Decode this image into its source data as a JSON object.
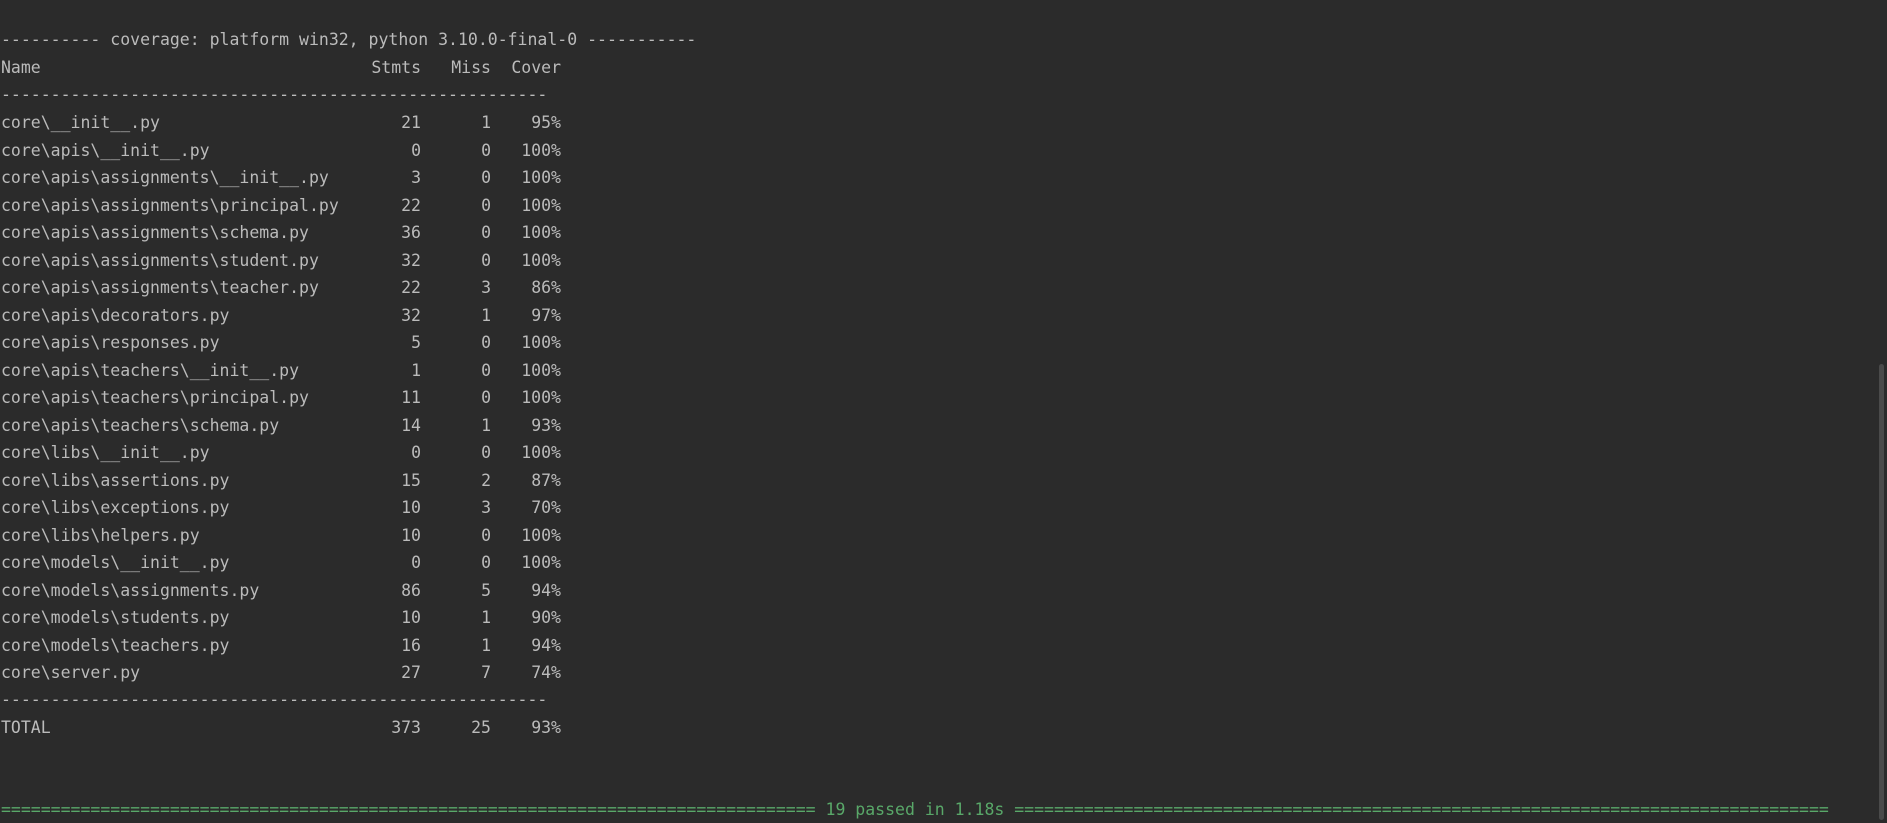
{
  "header_line": "---------- coverage: platform win32, python 3.10.0-final-0 -----------",
  "columns": {
    "name": "Name",
    "stmts": "Stmts",
    "miss": "Miss",
    "cover": "Cover"
  },
  "separator": "-------------------------------------------------------",
  "rows": [
    {
      "name": "core\\__init__.py",
      "stmts": "21",
      "miss": "1",
      "cover": "95%"
    },
    {
      "name": "core\\apis\\__init__.py",
      "stmts": "0",
      "miss": "0",
      "cover": "100%"
    },
    {
      "name": "core\\apis\\assignments\\__init__.py",
      "stmts": "3",
      "miss": "0",
      "cover": "100%"
    },
    {
      "name": "core\\apis\\assignments\\principal.py",
      "stmts": "22",
      "miss": "0",
      "cover": "100%"
    },
    {
      "name": "core\\apis\\assignments\\schema.py",
      "stmts": "36",
      "miss": "0",
      "cover": "100%"
    },
    {
      "name": "core\\apis\\assignments\\student.py",
      "stmts": "32",
      "miss": "0",
      "cover": "100%"
    },
    {
      "name": "core\\apis\\assignments\\teacher.py",
      "stmts": "22",
      "miss": "3",
      "cover": "86%"
    },
    {
      "name": "core\\apis\\decorators.py",
      "stmts": "32",
      "miss": "1",
      "cover": "97%"
    },
    {
      "name": "core\\apis\\responses.py",
      "stmts": "5",
      "miss": "0",
      "cover": "100%"
    },
    {
      "name": "core\\apis\\teachers\\__init__.py",
      "stmts": "1",
      "miss": "0",
      "cover": "100%"
    },
    {
      "name": "core\\apis\\teachers\\principal.py",
      "stmts": "11",
      "miss": "0",
      "cover": "100%"
    },
    {
      "name": "core\\apis\\teachers\\schema.py",
      "stmts": "14",
      "miss": "1",
      "cover": "93%"
    },
    {
      "name": "core\\libs\\__init__.py",
      "stmts": "0",
      "miss": "0",
      "cover": "100%"
    },
    {
      "name": "core\\libs\\assertions.py",
      "stmts": "15",
      "miss": "2",
      "cover": "87%"
    },
    {
      "name": "core\\libs\\exceptions.py",
      "stmts": "10",
      "miss": "3",
      "cover": "70%"
    },
    {
      "name": "core\\libs\\helpers.py",
      "stmts": "10",
      "miss": "0",
      "cover": "100%"
    },
    {
      "name": "core\\models\\__init__.py",
      "stmts": "0",
      "miss": "0",
      "cover": "100%"
    },
    {
      "name": "core\\models\\assignments.py",
      "stmts": "86",
      "miss": "5",
      "cover": "94%"
    },
    {
      "name": "core\\models\\students.py",
      "stmts": "10",
      "miss": "1",
      "cover": "90%"
    },
    {
      "name": "core\\models\\teachers.py",
      "stmts": "16",
      "miss": "1",
      "cover": "94%"
    },
    {
      "name": "core\\server.py",
      "stmts": "27",
      "miss": "7",
      "cover": "74%"
    }
  ],
  "total": {
    "name": "TOTAL",
    "stmts": "373",
    "miss": "25",
    "cover": "93%"
  },
  "summary": "================================================================================== 19 passed in 1.18s ==================================================================================",
  "colors": {
    "background": "#2b2b2b",
    "text": "#bbbbbb",
    "passed": "#59a869"
  }
}
